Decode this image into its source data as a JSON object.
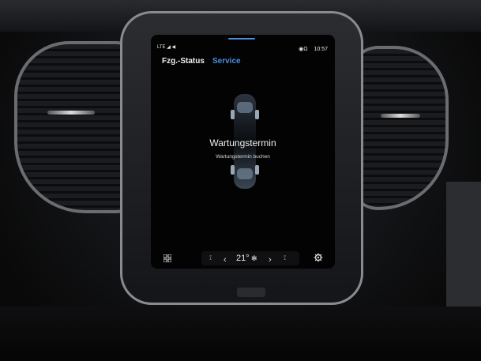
{
  "status": {
    "signal": "LTE ◢ ◀",
    "indicator": "◉Ω",
    "time": "10:57"
  },
  "tabs": [
    {
      "label": "Fzg.-Status",
      "active": false
    },
    {
      "label": "Service",
      "active": true
    }
  ],
  "service": {
    "title": "Wartungstermin",
    "subtitle": "Wartungstermin buchen"
  },
  "climate": {
    "temperature": "21°",
    "left_chevron": "‹",
    "right_chevron": "›"
  },
  "colors": {
    "accent": "#4a8fe0",
    "screen_bg": "#030304"
  },
  "icons": [
    "apps-grid-icon",
    "heated-seat-icon",
    "fan-icon",
    "gear-icon",
    "car-topview-icon"
  ]
}
